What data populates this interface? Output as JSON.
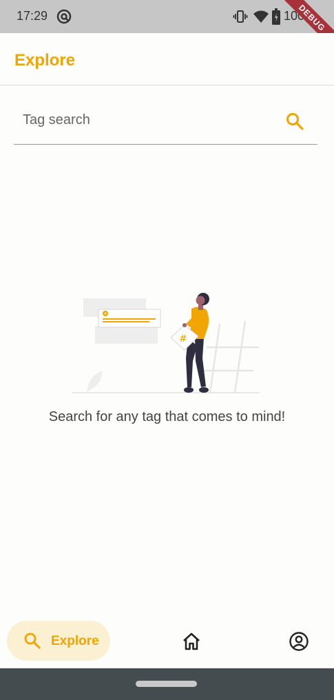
{
  "status_bar": {
    "time": "17:29",
    "battery_text": "100%",
    "icons": [
      "app-notification-icon",
      "vibrate-icon",
      "wifi-icon",
      "battery-icon"
    ]
  },
  "debug_banner": "DEBUG",
  "app_bar": {
    "title": "Explore"
  },
  "search": {
    "placeholder": "Tag search",
    "value": ""
  },
  "empty_state": {
    "illustration": "person-holding-hashtag-card",
    "message": "Search for any tag that comes to mind!"
  },
  "bottom_nav": {
    "items": [
      {
        "label": "Explore",
        "icon": "search-icon",
        "active": true
      },
      {
        "label": "",
        "icon": "home-icon",
        "active": false
      },
      {
        "label": "",
        "icon": "profile-icon",
        "active": false
      }
    ]
  },
  "colors": {
    "accent": "#f0a500",
    "accent_soft": "#fbf0d2",
    "status_bar": "#c6c6c6",
    "system_nav": "#444c4f",
    "debug_ribbon": "#a8323a"
  }
}
